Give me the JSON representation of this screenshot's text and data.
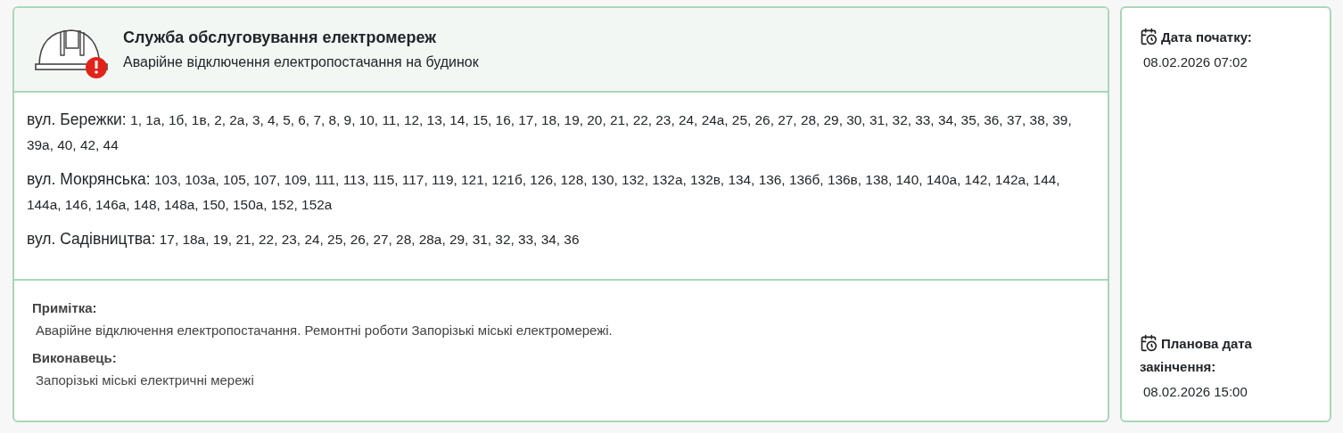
{
  "header": {
    "title": "Служба обслуговування електромереж",
    "subtitle": "Аварійне відключення електропостачання на будинок"
  },
  "streets": [
    {
      "street": "вул. Бережки:",
      "houses": "1, 1а, 1б, 1в, 2, 2а, 3, 4, 5, 6, 7, 8, 9, 10, 11, 12, 13, 14, 15, 16, 17, 18, 19, 20, 21, 22, 23, 24, 24а, 25, 26, 27, 28, 29, 30, 31, 32, 33, 34, 35, 36, 37, 38, 39, 39а, 40, 42, 44"
    },
    {
      "street": "вул. Мокрянська:",
      "houses": "103, 103а, 105, 107, 109, 111, 113, 115, 117, 119, 121, 121б, 126, 128, 130, 132, 132а, 132в, 134, 136, 136б, 136в, 138, 140, 140а, 142, 142а, 144, 144а, 146, 146а, 148, 148а, 150, 150а, 152, 152а"
    },
    {
      "street": "вул. Садівництва:",
      "houses": "17, 18а, 19, 21, 22, 23, 24, 25, 26, 27, 28, 28а, 29, 31, 32, 33, 34, 36"
    }
  ],
  "details": [
    {
      "label": "Примітка:",
      "value": "Аварійне відключення електропостачання. Ремонтні роботи Запорізькі міські електромережі."
    },
    {
      "label": "Виконавець:",
      "value": "Запорізькі міські електричні мережі"
    }
  ],
  "dates": [
    {
      "label": "Дата початку:",
      "value": "08.02.2026 07:02"
    },
    {
      "label": "Планова дата закінчення:",
      "value": "08.02.2026 15:00"
    }
  ]
}
